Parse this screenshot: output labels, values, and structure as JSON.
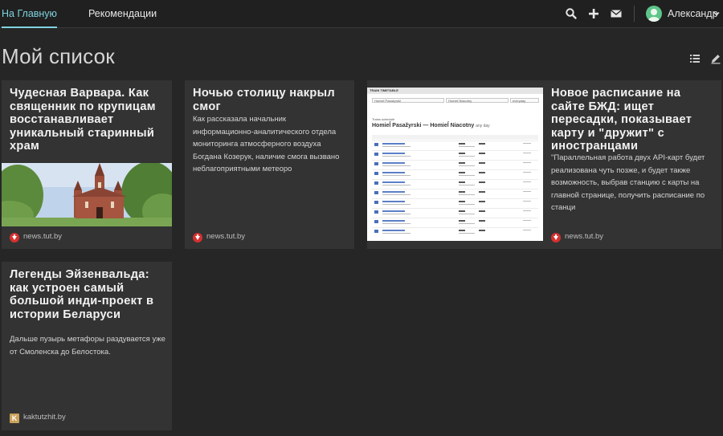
{
  "nav": {
    "tab_home": "На Главную",
    "tab_recommendations": "Рекомендации",
    "username": "Александр",
    "icons": [
      "search-icon",
      "plus-icon",
      "mail-icon",
      "chevron-down-icon"
    ]
  },
  "page": {
    "title": "Мой список",
    "icons": [
      "list-view-icon",
      "edit-icon"
    ]
  },
  "cards": [
    {
      "title": "Чудесная Варвара. Как священник по крупицам восстанавливает уникальный старинный храм",
      "image": "church-photo",
      "source": "news.tut.by"
    },
    {
      "title": "Ночью столицу накрыл смог",
      "text": "Как рассказала начальник информационно-аналитического отдела мониторинга атмосферного воздуха Богдана Козерук, наличие смога вызвано неблагоприятными метеоро",
      "source": "news.tut.by"
    },
    {
      "image": "train-timetable-screenshot",
      "thumb_header": "TRAIN TIMETABLE",
      "thumb_route": "Homieĺ Pasažyrski — Homieĺ Niacotny",
      "thumb_suffix": "any day",
      "thumb_subtitle": "Trains schedule",
      "thumb_field_a": "Homieĺ Pasažyrski",
      "thumb_field_b": "Homieĺ Niacotny",
      "thumb_field_c": "everyday"
    },
    {
      "title": "Новое расписание на сайте БЖД: ищет пересадки, показывает карту и \"дружит\" с иностранцами",
      "text": "\"Параллельная работа двух API-карт будет реализована чуть позже, и будет также возможность, выбрав станцию с карты на главной странице, получить расписание по станци",
      "source": "news.tut.by"
    },
    {
      "title": "Легенды Эйзенвальда: как устроен самый большой инди-проект в истории Беларуси",
      "text": "Дальше пузырь метафоры раздувается уже от Смоленска до Белостока.",
      "source": "kaktutzhit.by"
    }
  ],
  "colors": {
    "accent": "#7fd3df",
    "source_icon": "#d63030",
    "background": "#262626",
    "card": "#333333"
  }
}
